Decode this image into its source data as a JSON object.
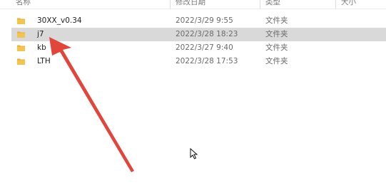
{
  "columns": {
    "name": "名称",
    "date_modified": "修改日期",
    "type": "类型",
    "size": "大小"
  },
  "files": [
    {
      "name": "30XX_v0.34",
      "date": "2022/3/29 9:55",
      "type": "文件夹",
      "selected": false
    },
    {
      "name": "j7",
      "date": "2022/3/28 18:23",
      "type": "文件夹",
      "selected": true
    },
    {
      "name": "kb",
      "date": "2022/3/27 9:40",
      "type": "文件夹",
      "selected": false
    },
    {
      "name": "LTH",
      "date": "2022/3/28 17:53",
      "type": "文件夹",
      "selected": false
    }
  ],
  "icons": {
    "folder": "folder-icon",
    "cursor": "mouse-cursor-icon",
    "annotation": "red-arrow"
  },
  "colors": {
    "selection": "#d9d9d9",
    "folder": "#e8b13a",
    "arrow": "#e0463c"
  }
}
